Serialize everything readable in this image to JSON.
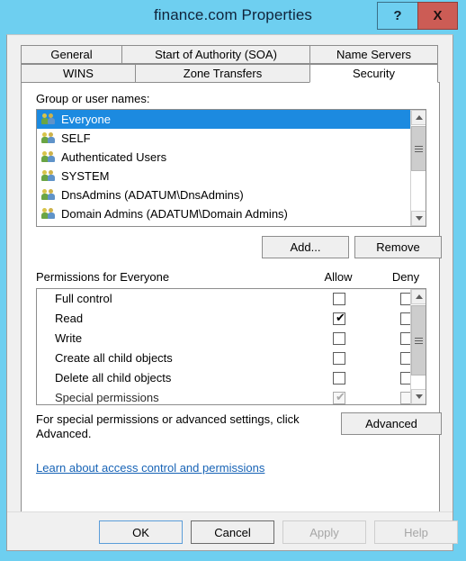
{
  "window": {
    "title": "finance.com Properties",
    "caption_buttons": [
      {
        "name": "help",
        "glyph": "?"
      },
      {
        "name": "close",
        "glyph": "X"
      }
    ],
    "colors": {
      "titlebar": "#6ecff0",
      "close_button": "#cc5c55",
      "selection": "#1c8ae0",
      "link": "#1763b6"
    }
  },
  "tabs": {
    "row1": [
      {
        "label": "General",
        "active": false
      },
      {
        "label": "Start of Authority (SOA)",
        "active": false
      },
      {
        "label": "Name Servers",
        "active": false
      }
    ],
    "row2": [
      {
        "label": "WINS",
        "active": false
      },
      {
        "label": "Zone Transfers",
        "active": false
      },
      {
        "label": "Security",
        "active": true
      }
    ]
  },
  "security": {
    "groups_label": "Group or user names:",
    "groups": [
      {
        "name": "Everyone",
        "selected": true
      },
      {
        "name": "SELF",
        "selected": false
      },
      {
        "name": "Authenticated Users",
        "selected": false
      },
      {
        "name": "SYSTEM",
        "selected": false
      },
      {
        "name": "DnsAdmins (ADATUM\\DnsAdmins)",
        "selected": false
      },
      {
        "name": "Domain Admins (ADATUM\\Domain Admins)",
        "selected": false
      },
      {
        "name": "",
        "selected": false
      }
    ],
    "add_label": "Add...",
    "remove_label": "Remove",
    "permissions_label": "Permissions for Everyone",
    "allow_header": "Allow",
    "deny_header": "Deny",
    "permissions": [
      {
        "name": "Full control",
        "allow": false,
        "deny": false,
        "disabled": false
      },
      {
        "name": "Read",
        "allow": true,
        "deny": false,
        "disabled": false
      },
      {
        "name": "Write",
        "allow": false,
        "deny": false,
        "disabled": false
      },
      {
        "name": "Create all child objects",
        "allow": false,
        "deny": false,
        "disabled": false
      },
      {
        "name": "Delete all child objects",
        "allow": false,
        "deny": false,
        "disabled": false
      },
      {
        "name": "Special permissions",
        "allow": true,
        "deny": false,
        "disabled": true
      }
    ],
    "advanced_note": "For special permissions or advanced settings, click Advanced.",
    "advanced_label": "Advanced",
    "link_text": "Learn about access control and permissions"
  },
  "buttons": {
    "ok": "OK",
    "cancel": "Cancel",
    "apply": "Apply",
    "help": "Help"
  }
}
